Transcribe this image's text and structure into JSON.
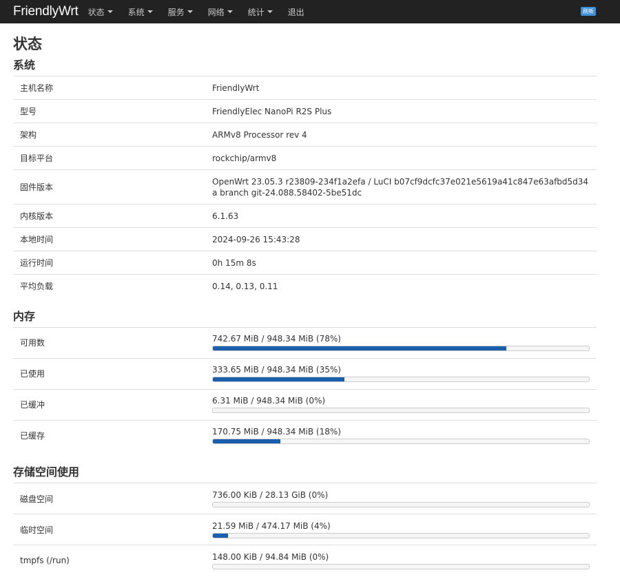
{
  "nav": {
    "brand": "FriendlyWrt",
    "items": [
      {
        "label": "状态",
        "dropdown": true
      },
      {
        "label": "系统",
        "dropdown": true
      },
      {
        "label": "服务",
        "dropdown": true
      },
      {
        "label": "网络",
        "dropdown": true
      },
      {
        "label": "统计",
        "dropdown": true
      },
      {
        "label": "退出",
        "dropdown": false
      }
    ],
    "refresh_badge": "刷新"
  },
  "page": {
    "title": "状态"
  },
  "system": {
    "title": "系统",
    "rows": [
      {
        "label": "主机名称",
        "value": "FriendlyWrt"
      },
      {
        "label": "型号",
        "value": "FriendlyElec NanoPi R2S Plus"
      },
      {
        "label": "架构",
        "value": "ARMv8 Processor rev 4"
      },
      {
        "label": "目标平台",
        "value": "rockchip/armv8"
      },
      {
        "label": "固件版本",
        "value": "OpenWrt 23.05.3 r23809-234f1a2efa / LuCI b07cf9dcfc37e021e5619a41c847e63afbd5d34a branch git-24.088.58402-5be51dc"
      },
      {
        "label": "内核版本",
        "value": "6.1.63"
      },
      {
        "label": "本地时间",
        "value": "2024-09-26 15:43:28"
      },
      {
        "label": "运行时间",
        "value": "0h 15m 8s"
      },
      {
        "label": "平均负载",
        "value": "0.14, 0.13, 0.11"
      }
    ]
  },
  "memory": {
    "title": "内存",
    "rows": [
      {
        "label": "可用数",
        "text": "742.67 MiB / 948.34 MiB (78%)",
        "percent": 78
      },
      {
        "label": "已使用",
        "text": "333.65 MiB / 948.34 MiB (35%)",
        "percent": 35
      },
      {
        "label": "已缓冲",
        "text": "6.31 MiB / 948.34 MiB (0%)",
        "percent": 0
      },
      {
        "label": "已缓存",
        "text": "170.75 MiB / 948.34 MiB (18%)",
        "percent": 18
      }
    ]
  },
  "storage": {
    "title": "存储空间使用",
    "rows": [
      {
        "label": "磁盘空间",
        "text": "736.00 KiB / 28.13 GiB (0%)",
        "percent": 0
      },
      {
        "label": "临时空间",
        "text": "21.59 MiB / 474.17 MiB (4%)",
        "percent": 4
      },
      {
        "label": "tmpfs (/run)",
        "text": "148.00 KiB / 94.84 MiB (0%)",
        "percent": 0
      }
    ]
  },
  "colors": {
    "navbar_bg": "#222222",
    "bar_fill": "#1a5fae",
    "refresh_badge": "#3a8fd6"
  }
}
